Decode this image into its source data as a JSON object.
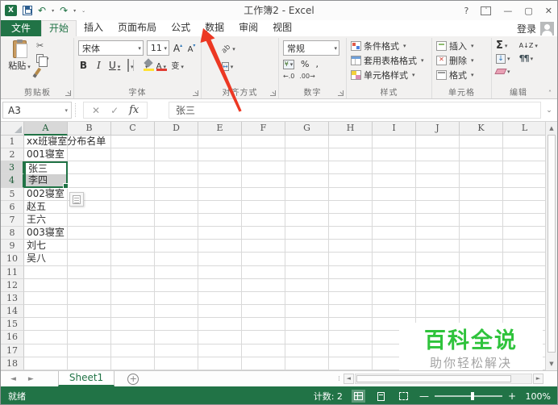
{
  "window": {
    "title": "工作簿2 - Excel"
  },
  "icons": {
    "undo": "↶",
    "redo": "↷",
    "qat_more": "⌄",
    "help": "?",
    "minimize": "—",
    "maximize": "▢",
    "close": "✕",
    "ribbon_display": "˄",
    "scissors": "✂",
    "grow_font": "A",
    "shrink_font": "A",
    "tri_up": "▴",
    "tri_down": "▾",
    "orientation": "ab",
    "merge_arrows": "↔",
    "percent": "%",
    "comma": ",",
    "currency": "¥",
    "inc_decimal": "←.0",
    "dec_decimal": ".00→",
    "sum": "Σ",
    "sort_az": "A↓Z",
    "fill_down": "↓",
    "find": "¶¶",
    "formula_x": "✕",
    "formula_check": "✓",
    "fx": "fx",
    "chevron_down": "⌄",
    "nav_left": "◄",
    "nav_right": "►",
    "scroll_up": "▲",
    "scroll_down": "▼",
    "add_sheet": "+",
    "grip": "⁞",
    "zoom_minus": "—",
    "zoom_plus": "+",
    "collapse_ribbon": "˄"
  },
  "menu": {
    "file": "文件",
    "tabs": [
      "开始",
      "插入",
      "页面布局",
      "公式",
      "数据",
      "审阅",
      "视图"
    ],
    "active_tab": "开始",
    "arrow_points_to": "数据",
    "sign_in": "登录"
  },
  "ribbon": {
    "clipboard": {
      "paste": "粘贴",
      "label": "剪贴板"
    },
    "font": {
      "name": "宋体",
      "size": "11",
      "bold": "B",
      "italic": "I",
      "underline": "U",
      "phonetic": "变",
      "label": "字体"
    },
    "alignment": {
      "label": "对齐方式"
    },
    "number": {
      "format": "常规",
      "label": "数字"
    },
    "styles": {
      "items": [
        "条件格式",
        "套用表格格式",
        "单元格样式"
      ],
      "label": "样式"
    },
    "cells": {
      "items": [
        "插入",
        "删除",
        "格式"
      ],
      "label": "单元格"
    },
    "editing": {
      "label": "编辑"
    }
  },
  "formula_bar": {
    "name_box": "A3",
    "content": "张三"
  },
  "grid": {
    "columns": [
      "A",
      "B",
      "C",
      "D",
      "E",
      "F",
      "G",
      "H",
      "I",
      "J",
      "K",
      "L"
    ],
    "row_count": 18,
    "selected_column": "A",
    "selected_rows": [
      3,
      4
    ],
    "selection": {
      "active": "A3",
      "range_extra": "A4"
    },
    "cells": {
      "A1": "xx班寝室分布名单",
      "A2": "001寝室",
      "A3": "张三",
      "A4": "李四",
      "A5": "002寝室",
      "A6": "赵五",
      "A7": "王六",
      "A8": "003寝室",
      "A9": "刘七",
      "A10": "吴八"
    }
  },
  "watermark": {
    "title": "百科全说",
    "subtitle": "助你轻松解决"
  },
  "sheet_bar": {
    "active_tab": "Sheet1"
  },
  "status_bar": {
    "mode": "就绪",
    "count": "计数: 2",
    "zoom": "100%"
  },
  "colors": {
    "excel_green": "#217346",
    "arrow_red": "#ec3823",
    "watermark_green": "#2fc33c",
    "selection_fill": "#d0d0d0"
  }
}
